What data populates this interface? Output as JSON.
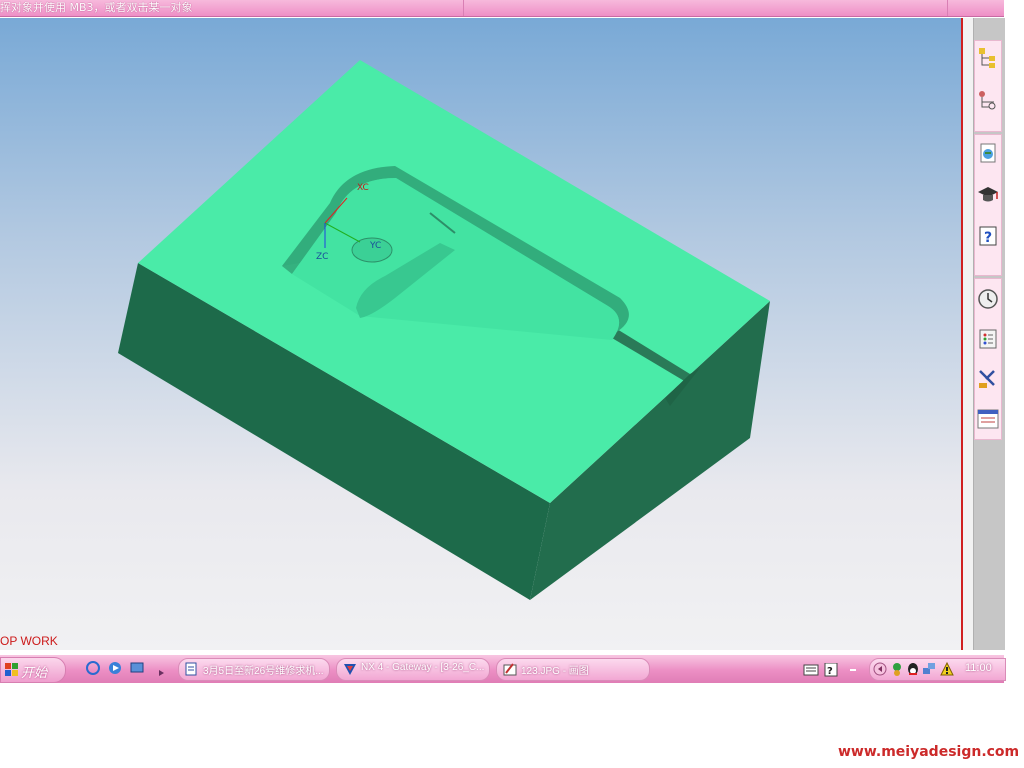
{
  "cue_line": "挥对象并使用 MB3，或者双击某一对象",
  "viewport": {
    "status_left": "OP WORK",
    "wcs_labels": {
      "xc": "XC",
      "yc": "YC",
      "zc": "ZC"
    },
    "colors": {
      "top": "#4bedaa",
      "left": "#1d6a4a",
      "front": "#216c4c",
      "pocket": "#3ed49a"
    }
  },
  "resource_bar": {
    "icons": [
      "assembly-navigator-icon",
      "part-navigator-icon",
      "web-browser-icon",
      "training-icon",
      "help-icon",
      "history-icon",
      "system-materials-icon",
      "roles-icon",
      "reuse-library-icon"
    ]
  },
  "taskbar": {
    "start_label": "开始",
    "tasks": [
      {
        "label": "3月5日至新26号维修求机...",
        "icon": "document-icon"
      },
      {
        "label": "NX 4 - Gateway - [3-26_C...",
        "icon": "nx-icon"
      },
      {
        "label": "123.JPG - 画图",
        "icon": "paint-icon"
      }
    ],
    "clock": "11:00"
  },
  "watermark": "www.meiyadesign.com"
}
